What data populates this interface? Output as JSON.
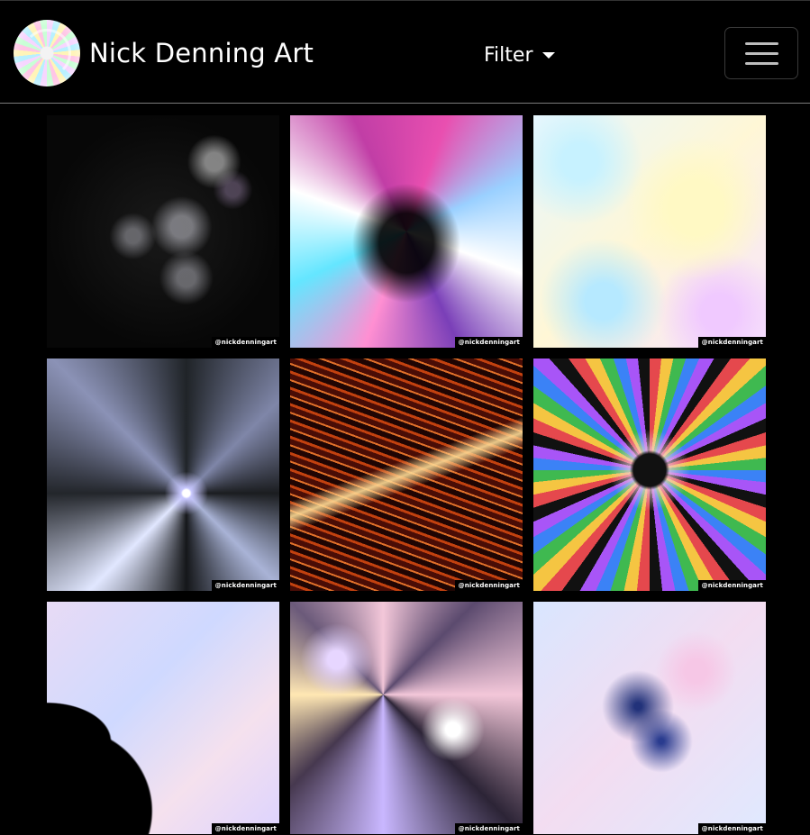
{
  "site": {
    "title": "Nick Denning Art"
  },
  "nav": {
    "filter_label": "Filter",
    "menu_icon": "hamburger-menu-icon",
    "logo_icon": "spiral-logo-icon"
  },
  "gallery": {
    "items": [
      {
        "watermark": "@nickdenningart"
      },
      {
        "watermark": "@nickdenningart"
      },
      {
        "watermark": "@nickdenningart"
      },
      {
        "watermark": "@nickdenningart"
      },
      {
        "watermark": "@nickdenningart"
      },
      {
        "watermark": "@nickdenningart"
      },
      {
        "watermark": "@nickdenningart"
      },
      {
        "watermark": "@nickdenningart"
      },
      {
        "watermark": "@nickdenningart"
      }
    ]
  },
  "colors": {
    "background": "#000000",
    "text": "#ffffff",
    "navbar_border": "#7a7a7a"
  }
}
